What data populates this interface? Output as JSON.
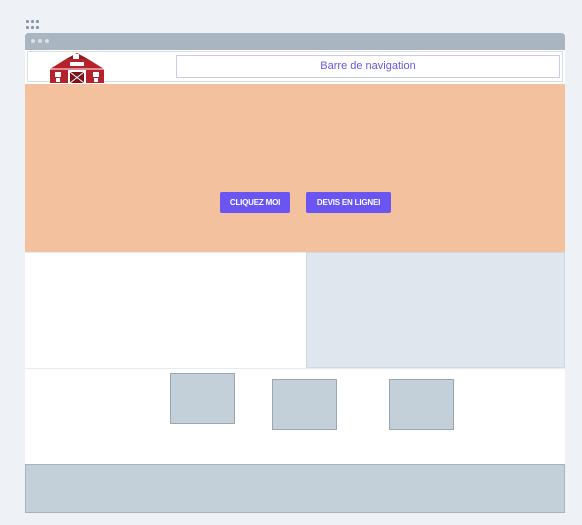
{
  "header": {
    "logo_icon": "barn-icon",
    "nav_label": "Barre de navigation"
  },
  "hero": {
    "buttons": [
      {
        "label": "CLIQUEZ MOI"
      },
      {
        "label": "DEVIS EN LIGNEI"
      }
    ]
  },
  "colors": {
    "hero_bg": "#f3c19e",
    "button_bg": "#6a54f2",
    "nav_text": "#6659e6",
    "placeholder_gray": "#c4d0d9"
  }
}
